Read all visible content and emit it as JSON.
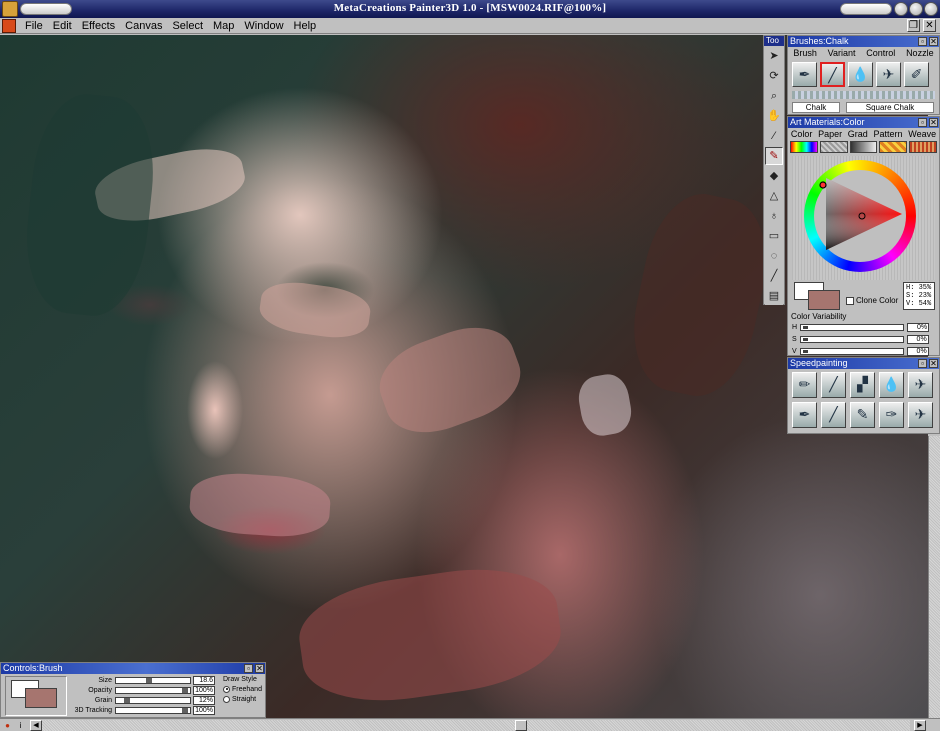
{
  "window": {
    "title": "MetaCreations Painter3D 1.0 - [MSW0024.RIF@100%]"
  },
  "menu": [
    "File",
    "Edit",
    "Effects",
    "Canvas",
    "Select",
    "Map",
    "Window",
    "Help"
  ],
  "toolbox": {
    "title": "Too",
    "tools": [
      "pointer-icon",
      "rotate-icon",
      "magnifier-icon",
      "grabber-icon",
      "dropper-icon",
      "brush-icon",
      "paint-bucket-icon",
      "cone-icon",
      "bulb-icon",
      "rectangle-select-icon",
      "lasso-icon",
      "line-icon",
      "stack-icon"
    ]
  },
  "brushes": {
    "title": "Brushes:Chalk",
    "tabs": [
      "Brush",
      "Variant",
      "Control",
      "Nozzle"
    ],
    "icons": [
      "pen-icon",
      "chalk-icon",
      "water-drop-icon",
      "airbrush-icon",
      "felt-pen-icon"
    ],
    "brush_name": "Chalk",
    "variant_name": "Square Chalk"
  },
  "art_materials": {
    "title": "Art Materials:Color",
    "tabs": [
      "Color",
      "Paper",
      "Grad",
      "Pattern",
      "Weave"
    ],
    "hsv": {
      "h": "H: 35%",
      "s": "S: 23%",
      "v": "V: 54%"
    },
    "clone_color_label": "Clone Color",
    "variability_title": "Color Variability",
    "variability_values": [
      "0%",
      "0%",
      "0%"
    ],
    "colors": {
      "primary": "#ffffff",
      "secondary": "#a6756f"
    }
  },
  "speedpainting": {
    "title": "Speedpainting",
    "icons": [
      "pencil-icon",
      "chalk-icon",
      "chalk-icon",
      "water-drop-icon",
      "airbrush-icon",
      "pen-icon",
      "chalk-icon",
      "brush-icon",
      "pen-icon",
      "airbrush-icon"
    ]
  },
  "controls": {
    "title": "Controls:Brush",
    "rows": [
      {
        "label": "Size",
        "value": "18.6",
        "level": 0.45
      },
      {
        "label": "Opacity",
        "value": "100%",
        "level": 1.0
      },
      {
        "label": "Grain",
        "value": "12%",
        "level": 0.12
      },
      {
        "label": "3D Tracking",
        "value": "100%",
        "level": 1.0
      }
    ],
    "draw_style_label": "Draw Style",
    "freehand_label": "Freehand",
    "straight_label": "Straight"
  }
}
